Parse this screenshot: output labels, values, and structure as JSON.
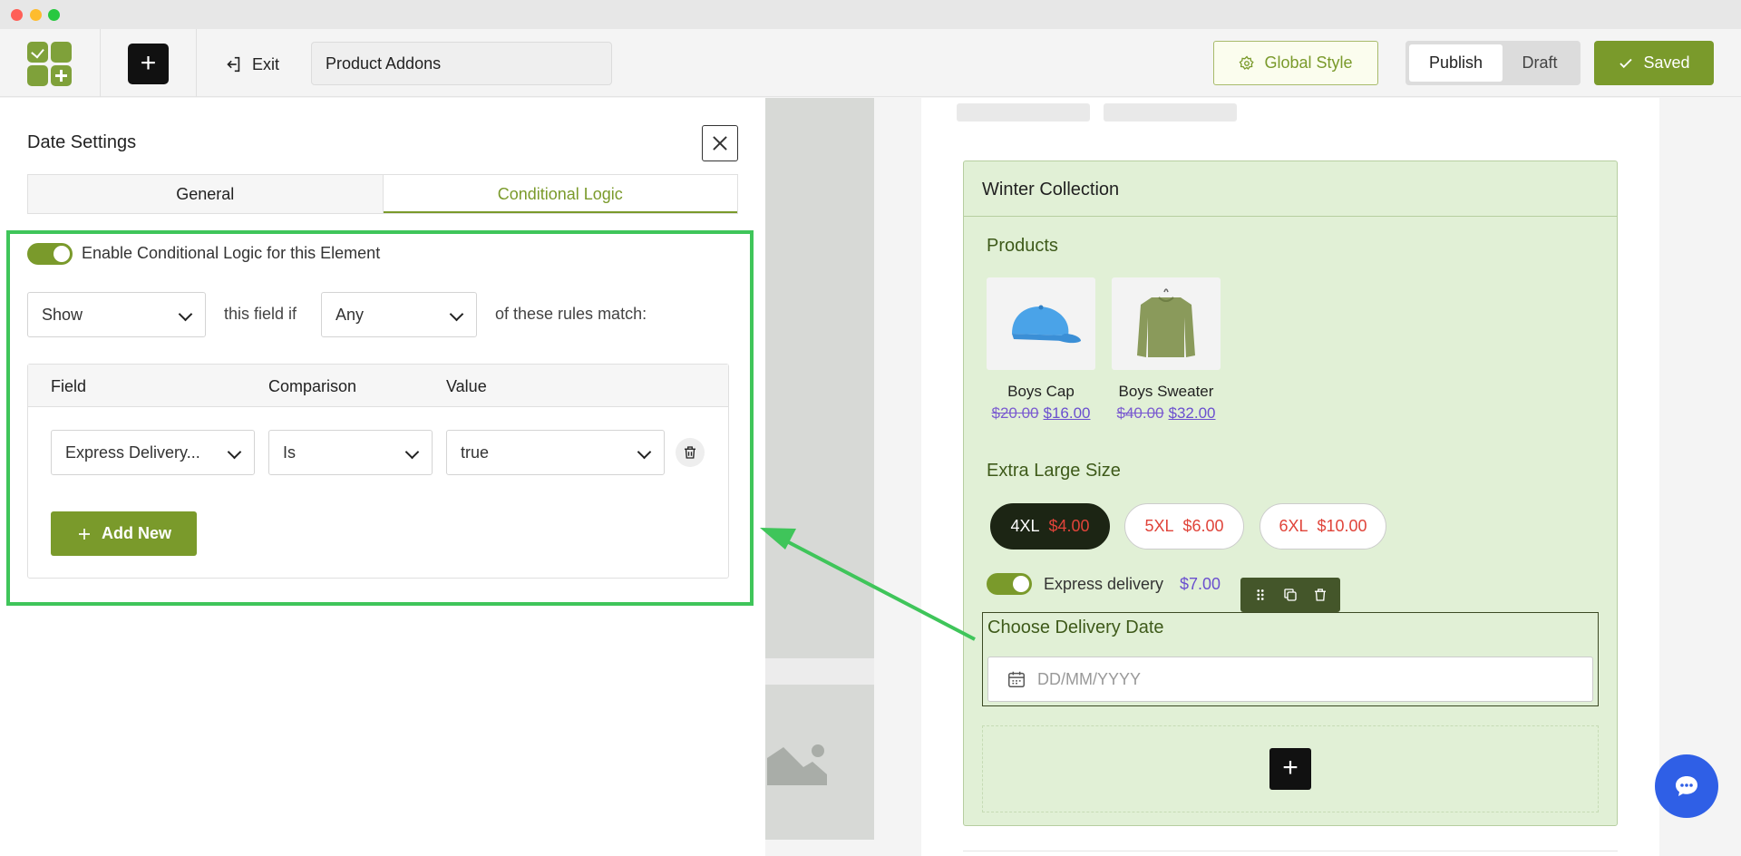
{
  "toolbar": {
    "exit_label": "Exit",
    "title_value": "Product Addons",
    "global_style_label": "Global Style",
    "publish_label": "Publish",
    "draft_label": "Draft",
    "saved_label": "Saved"
  },
  "panel": {
    "title": "Date Settings",
    "tabs": [
      {
        "label": "General",
        "active": false
      },
      {
        "label": "Conditional Logic",
        "active": true
      }
    ],
    "enable_label": "Enable Conditional Logic for this Element",
    "enable_on": true,
    "action_value": "Show",
    "this_field_if": "this field if",
    "match_value": "Any",
    "rules_match": "of these rules match:",
    "rules_headers": [
      "Field",
      "Comparison",
      "Value"
    ],
    "rule": {
      "field": "Express Delivery...",
      "comparison": "Is",
      "value": "true"
    },
    "add_new_label": "Add New"
  },
  "preview": {
    "card_title": "Winter Collection",
    "products_title": "Products",
    "products": [
      {
        "name": "Boys Cap",
        "old_price": "$20.00",
        "new_price": "$16.00"
      },
      {
        "name": "Boys Sweater",
        "old_price": "$40.00",
        "new_price": "$32.00"
      }
    ],
    "size_title": "Extra Large Size",
    "sizes": [
      {
        "label": "4XL",
        "price": "$4.00",
        "selected": true
      },
      {
        "label": "5XL",
        "price": "$6.00",
        "selected": false
      },
      {
        "label": "6XL",
        "price": "$10.00",
        "selected": false
      }
    ],
    "express_label": "Express delivery",
    "express_price": "$7.00",
    "date_title": "Choose Delivery Date",
    "date_placeholder": "DD/MM/YYYY"
  },
  "colors": {
    "accent": "#7a9a2b",
    "highlight": "#3fc55a",
    "card_bg": "#e1f0d6",
    "price_new": "#6a4fcf",
    "price_size": "#e0443a",
    "chat": "#2f5fe6"
  }
}
